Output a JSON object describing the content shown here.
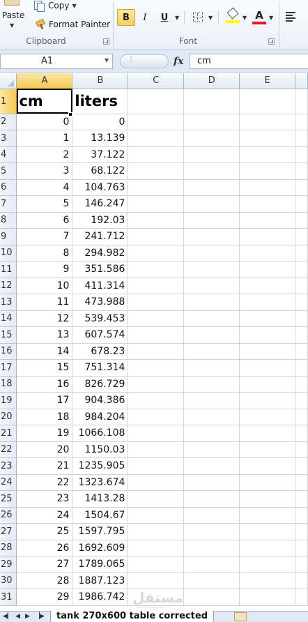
{
  "ribbon": {
    "paste_label": "Paste",
    "copy_label": "Copy",
    "format_painter_label": "Format Painter",
    "clipboard_group_label": "Clipboard",
    "font_group_label": "Font",
    "bold_glyph": "B",
    "italic_glyph": "I",
    "underline_glyph": "U",
    "font_color_glyph": "A",
    "fill_color": "#ffff00",
    "font_color": "#e01c1c"
  },
  "formula_bar": {
    "name_box": "A1",
    "fx_label": "fx",
    "formula": "cm"
  },
  "grid": {
    "columns": [
      "A",
      "B",
      "C",
      "D",
      "E"
    ],
    "selected_column": "A",
    "active_cell": "A1",
    "header_row": {
      "row": "1",
      "a": "cm",
      "b": "liters"
    },
    "rows": [
      {
        "row": "2",
        "a": "0",
        "b": "0"
      },
      {
        "row": "3",
        "a": "1",
        "b": "13.139"
      },
      {
        "row": "4",
        "a": "2",
        "b": "37.122"
      },
      {
        "row": "5",
        "a": "3",
        "b": "68.122"
      },
      {
        "row": "6",
        "a": "4",
        "b": "104.763"
      },
      {
        "row": "7",
        "a": "5",
        "b": "146.247"
      },
      {
        "row": "8",
        "a": "6",
        "b": "192.03"
      },
      {
        "row": "9",
        "a": "7",
        "b": "241.712"
      },
      {
        "row": "10",
        "a": "8",
        "b": "294.982"
      },
      {
        "row": "11",
        "a": "9",
        "b": "351.586"
      },
      {
        "row": "12",
        "a": "10",
        "b": "411.314"
      },
      {
        "row": "13",
        "a": "11",
        "b": "473.988"
      },
      {
        "row": "14",
        "a": "12",
        "b": "539.453"
      },
      {
        "row": "15",
        "a": "13",
        "b": "607.574"
      },
      {
        "row": "16",
        "a": "14",
        "b": "678.23"
      },
      {
        "row": "17",
        "a": "15",
        "b": "751.314"
      },
      {
        "row": "18",
        "a": "16",
        "b": "826.729"
      },
      {
        "row": "19",
        "a": "17",
        "b": "904.386"
      },
      {
        "row": "20",
        "a": "18",
        "b": "984.204"
      },
      {
        "row": "21",
        "a": "19",
        "b": "1066.108"
      },
      {
        "row": "22",
        "a": "20",
        "b": "1150.03"
      },
      {
        "row": "23",
        "a": "21",
        "b": "1235.905"
      },
      {
        "row": "24",
        "a": "22",
        "b": "1323.674"
      },
      {
        "row": "25",
        "a": "23",
        "b": "1413.28"
      },
      {
        "row": "26",
        "a": "24",
        "b": "1504.67"
      },
      {
        "row": "27",
        "a": "25",
        "b": "1597.795"
      },
      {
        "row": "28",
        "a": "26",
        "b": "1692.609"
      },
      {
        "row": "29",
        "a": "27",
        "b": "1789.065"
      },
      {
        "row": "30",
        "a": "28",
        "b": "1887.123"
      },
      {
        "row": "31",
        "a": "29",
        "b": "1986.742"
      }
    ]
  },
  "sheet_tabs": {
    "active_tab": "tank  270x600  table  corrected"
  },
  "watermark": {
    "text": "مستقل",
    "sub": "mostaql.com"
  }
}
